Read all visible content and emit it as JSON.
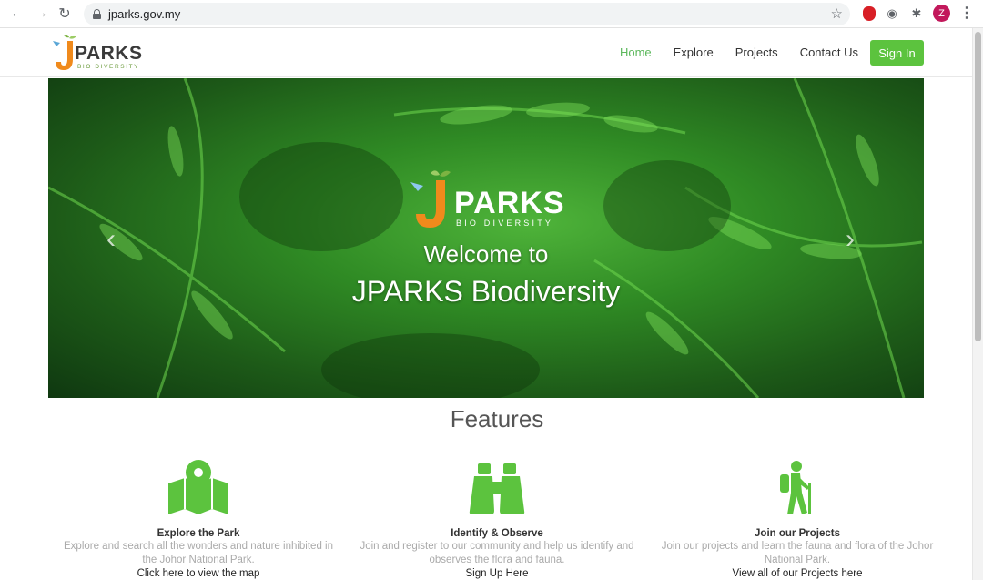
{
  "browser": {
    "url": "jparks.gov.my",
    "avatar_letter": "Z"
  },
  "site": {
    "logo_word": "PARKS",
    "logo_sub": "BIO DIVERSITY",
    "nav": [
      {
        "label": "Home",
        "active": true
      },
      {
        "label": "Explore",
        "active": false
      },
      {
        "label": "Projects",
        "active": false
      },
      {
        "label": "Contact Us",
        "active": false
      }
    ],
    "signin_label": "Sign In",
    "accent_color": "#5cc33e"
  },
  "hero": {
    "logo_word": "PARKS",
    "logo_sub": "BIO DIVERSITY",
    "welcome": "Welcome to",
    "title": "JPARKS Biodiversity",
    "prev_icon": "chevron-left-icon",
    "next_icon": "chevron-right-icon"
  },
  "features": {
    "title": "Features",
    "items": [
      {
        "icon": "map-pin-icon",
        "name": "Explore the Park",
        "description": "Explore and search all the wonders and nature inhibited in the Johor National Park.",
        "link": "Click here to view the map"
      },
      {
        "icon": "binoculars-icon",
        "name": "Identify & Observe",
        "description": "Join and register to our community and help us identify and observes the flora and fauna.",
        "link": "Sign Up Here"
      },
      {
        "icon": "hiker-icon",
        "name": "Join our Projects",
        "description": "Join our projects and learn the fauna and flora of the Johor National Park.",
        "link": "View all of our Projects here"
      }
    ]
  }
}
